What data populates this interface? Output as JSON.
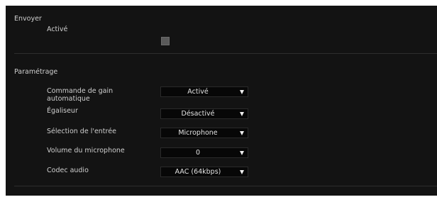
{
  "envoyer": {
    "title": "Envoyer",
    "active_label": "Activé",
    "active_checked": false
  },
  "parametrage": {
    "title": "Paramétrage",
    "rows": [
      {
        "label": "Commande de gain automatique",
        "value": "Activé"
      },
      {
        "label": "Égaliseur",
        "value": "Désactivé"
      },
      {
        "label": "Sélection de l'entrée",
        "value": "Microphone"
      },
      {
        "label": "Volume du microphone",
        "value": "0"
      },
      {
        "label": "Codec audio",
        "value": "AAC (64kbps)"
      }
    ]
  },
  "icons": {
    "dropdown": "chevron-down-icon"
  },
  "colors": {
    "panel_bg": "#131313",
    "select_bg": "#070707",
    "text": "#cfcfcf"
  }
}
